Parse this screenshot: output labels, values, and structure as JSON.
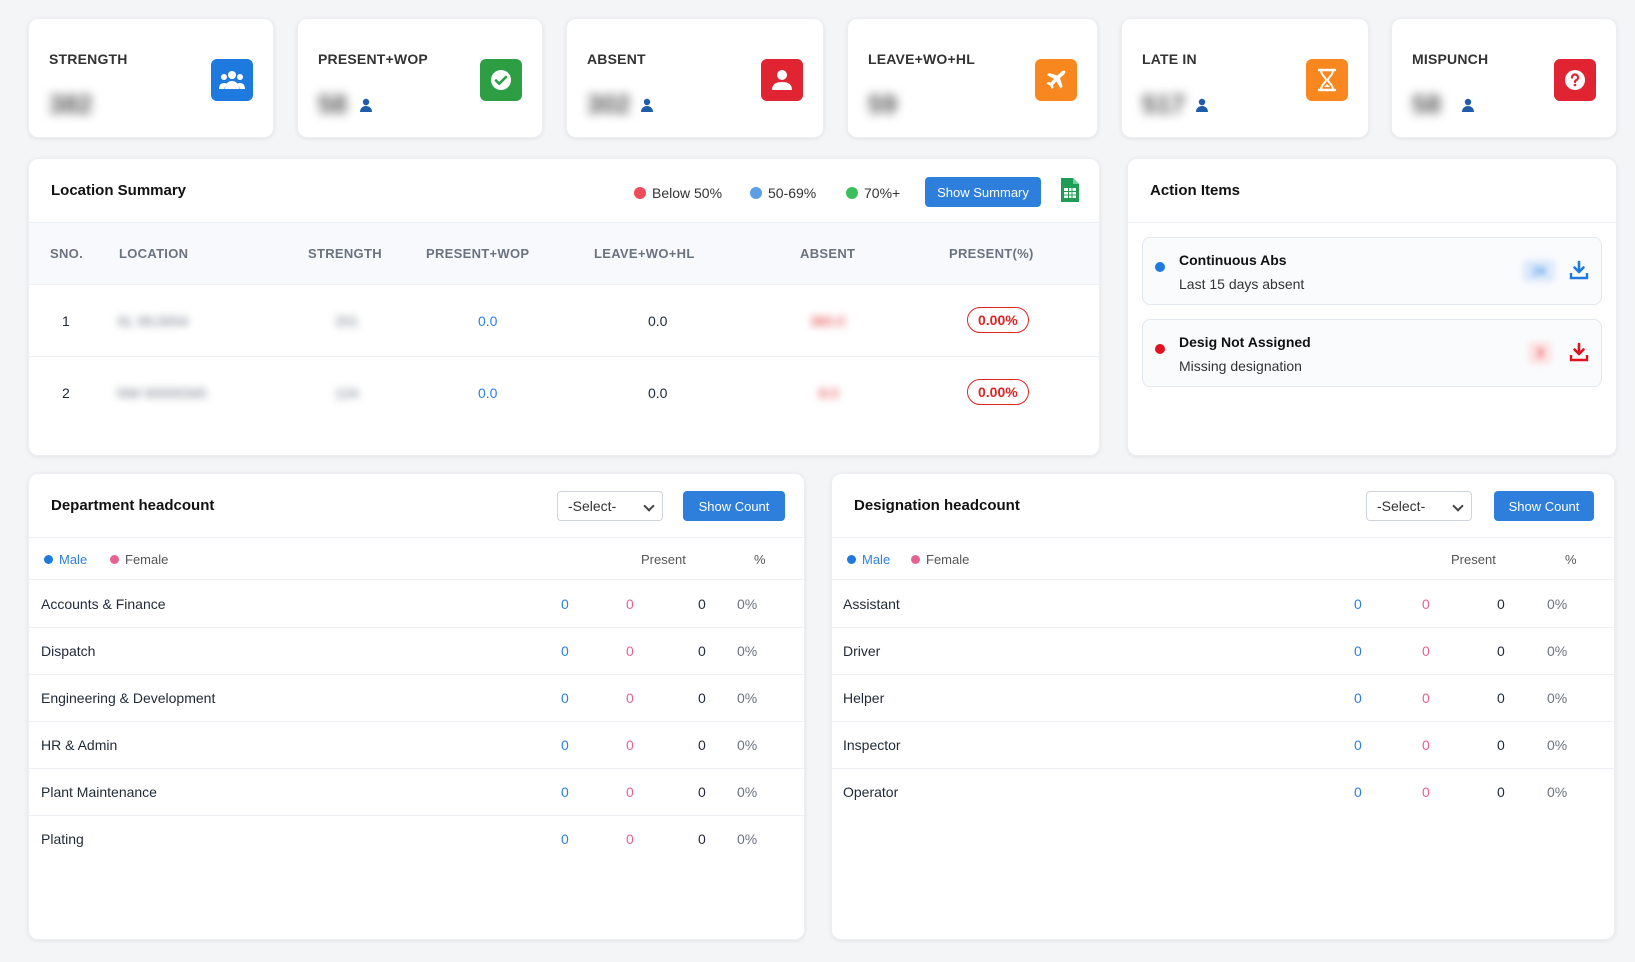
{
  "stats": [
    {
      "label": "STRENGTH",
      "value": "382",
      "icon": "users-icon",
      "color": "#1f7ae0"
    },
    {
      "label": "PRESENT+WOP",
      "value": "58",
      "icon": "check-circle-icon",
      "color": "#2e9e44"
    },
    {
      "label": "ABSENT",
      "value": "302",
      "icon": "user-icon",
      "color": "#e02432"
    },
    {
      "label": "LEAVE+WO+HL",
      "value": "59",
      "icon": "plane-icon",
      "color": "#f7871e"
    },
    {
      "label": "LATE IN",
      "value": "517",
      "icon": "hourglass-icon",
      "color": "#f7871e"
    },
    {
      "label": "MISPUNCH",
      "value": "58",
      "icon": "question-circle-icon",
      "color": "#e02432"
    }
  ],
  "location": {
    "title": "Location Summary",
    "legend": [
      {
        "label": "Below 50%",
        "color": "#ef4b5a"
      },
      {
        "label": "50-69%",
        "color": "#5a9fe8"
      },
      {
        "label": "70%+",
        "color": "#3bbf5c"
      }
    ],
    "show_summary": "Show Summary",
    "columns": [
      "SNO.",
      "LOCATION",
      "STRENGTH",
      "PRESENT+WOP",
      "LEAVE+WO+HL",
      "ABSENT",
      "PRESENT(%)"
    ],
    "rows": [
      {
        "sno": "1",
        "location": "SL 99,0004",
        "strength": "201",
        "present": "0.0",
        "leave": "0.0",
        "absent": "360.0",
        "pct": "0.00%"
      },
      {
        "sno": "2",
        "location": "NW 00000345",
        "strength": "124",
        "present": "0.0",
        "leave": "0.0",
        "absent": "8.0",
        "pct": "0.00%"
      }
    ]
  },
  "actions": {
    "title": "Action Items",
    "items": [
      {
        "title": "Continuous Abs",
        "subtitle": "Last 15 days absent",
        "count": "24",
        "dot_color": "#1f7ae0"
      },
      {
        "title": "Desig Not Assigned",
        "subtitle": "Missing designation",
        "count": "3",
        "dot_color": "#e0121e"
      }
    ]
  },
  "dept": {
    "title": "Department headcount",
    "select_value": "-Select-",
    "button": "Show Count",
    "legend_male": "Male",
    "legend_female": "Female",
    "col_present": "Present",
    "col_pct": "%",
    "rows": [
      {
        "name": "Accounts & Finance",
        "male": "0",
        "female": "0",
        "present": "0",
        "pct": "0%"
      },
      {
        "name": "Dispatch",
        "male": "0",
        "female": "0",
        "present": "0",
        "pct": "0%"
      },
      {
        "name": "Engineering & Development",
        "male": "0",
        "female": "0",
        "present": "0",
        "pct": "0%"
      },
      {
        "name": "HR & Admin",
        "male": "0",
        "female": "0",
        "present": "0",
        "pct": "0%"
      },
      {
        "name": "Plant Maintenance",
        "male": "0",
        "female": "0",
        "present": "0",
        "pct": "0%"
      },
      {
        "name": "Plating",
        "male": "0",
        "female": "0",
        "present": "0",
        "pct": "0%"
      }
    ]
  },
  "desig": {
    "title": "Designation headcount",
    "select_value": "-Select-",
    "button": "Show Count",
    "legend_male": "Male",
    "legend_female": "Female",
    "col_present": "Present",
    "col_pct": "%",
    "rows": [
      {
        "name": "Assistant",
        "male": "0",
        "female": "0",
        "present": "0",
        "pct": "0%"
      },
      {
        "name": "Driver",
        "male": "0",
        "female": "0",
        "present": "0",
        "pct": "0%"
      },
      {
        "name": "Helper",
        "male": "0",
        "female": "0",
        "present": "0",
        "pct": "0%"
      },
      {
        "name": "Inspector",
        "male": "0",
        "female": "0",
        "present": "0",
        "pct": "0%"
      },
      {
        "name": "Operator",
        "male": "0",
        "female": "0",
        "present": "0",
        "pct": "0%"
      }
    ]
  }
}
